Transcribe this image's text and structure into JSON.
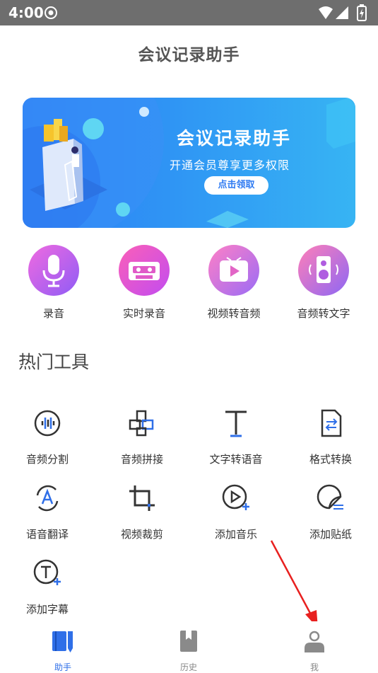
{
  "status_bar": {
    "time": "4:00"
  },
  "app": {
    "title": "会议记录助手"
  },
  "banner": {
    "title": "会议记录助手",
    "subtitle": "开通会员尊享更多权限",
    "button_label": "点击领取"
  },
  "features": [
    {
      "label": "录音",
      "icon": "microphone-icon"
    },
    {
      "label": "实时录音",
      "icon": "cassette-icon"
    },
    {
      "label": "视频转音频",
      "icon": "video-play-icon"
    },
    {
      "label": "音频转文字",
      "icon": "speaker-icon"
    }
  ],
  "hot_tools": {
    "title": "热门工具",
    "items": [
      {
        "label": "音频分割",
        "icon": "waveform-icon"
      },
      {
        "label": "音频拼接",
        "icon": "puzzle-icon"
      },
      {
        "label": "文字转语音",
        "icon": "text-t-icon"
      },
      {
        "label": "格式转换",
        "icon": "file-convert-icon"
      },
      {
        "label": "语音翻译",
        "icon": "translate-icon"
      },
      {
        "label": "视频裁剪",
        "icon": "crop-icon"
      },
      {
        "label": "添加音乐",
        "icon": "play-plus-icon"
      },
      {
        "label": "添加贴纸",
        "icon": "sticker-icon"
      },
      {
        "label": "添加字幕",
        "icon": "subtitle-icon"
      }
    ]
  },
  "tab_bar": {
    "active": "助手",
    "items": [
      {
        "label": "助手",
        "icon": "book-icon"
      },
      {
        "label": "历史",
        "icon": "bookmark-icon"
      },
      {
        "label": "我",
        "icon": "person-icon"
      }
    ]
  }
}
